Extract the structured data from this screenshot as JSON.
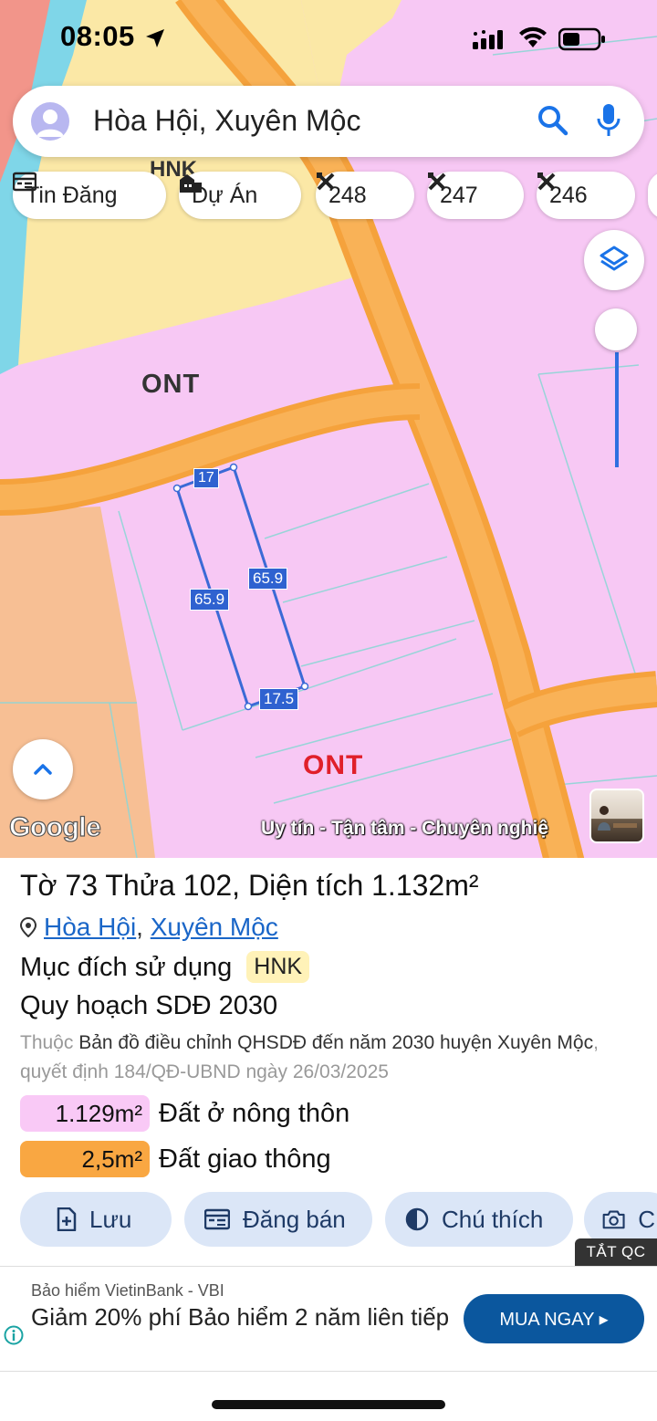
{
  "status_bar": {
    "time": "08:05"
  },
  "search": {
    "query": "Hòa Hội, Xuyên Mộc"
  },
  "chips": [
    {
      "label": "Tin Đăng",
      "icon": "newspaper-icon"
    },
    {
      "label": "Dự Án",
      "icon": "building-icon"
    },
    {
      "label": "248",
      "icon": "tools-icon"
    },
    {
      "label": "247",
      "icon": "tools-icon"
    },
    {
      "label": "246",
      "icon": "tools-icon"
    }
  ],
  "map": {
    "zone_labels": [
      "HNK",
      "ONT",
      "ONT"
    ],
    "edge_labels": [
      "17",
      "65.9",
      "65.9",
      "17.5"
    ],
    "google_logo": "Google",
    "watermark": "Uy tín - Tận tâm - Chuyên nghiệ"
  },
  "parcel": {
    "sheet_label": "Tờ",
    "sheet_no": "73",
    "lot_label": "Thửa",
    "lot_no": "102",
    "area_label": "Diện tích",
    "area": "1.132m²",
    "commune": "Hòa Hội",
    "district": "Xuyên Mộc",
    "purpose_label": "Mục đích sử dụng",
    "purpose_code": "HNK",
    "plan_title": "Quy hoạch SDĐ 2030",
    "desc_prefix": "Thuộc",
    "desc_main": "Bản đồ điều chỉnh QHSDĐ đến năm 2030 huyện Xuyên Mộc",
    "desc_suffix": ", quyết định 184/QĐ-UBND ngày 26/03/2025",
    "areas": [
      {
        "value": "1.129m²",
        "label": "Đất ở nông thôn",
        "color": "#f9c9f6"
      },
      {
        "value": "2,5m²",
        "label": "Đất giao thông",
        "color": "#f9a742"
      }
    ]
  },
  "actions": [
    {
      "label": "Lưu",
      "icon": "save-icon"
    },
    {
      "label": "Đăng bán",
      "icon": "post-icon"
    },
    {
      "label": "Chú thích",
      "icon": "legend-icon"
    },
    {
      "label": "C",
      "icon": "camera-icon"
    }
  ],
  "ad": {
    "hide_label": "TẮT QC",
    "source": "Bảo hiểm VietinBank - VBI",
    "headline": "Giảm 20% phí Bảo hiểm 2 năm liên tiếp",
    "cta": "MUA NGAY ▸"
  },
  "colors": {
    "accent": "#1a73e8",
    "residential": "#f7c8f4",
    "road": "#f9a742",
    "agri": "#fbe8a6"
  }
}
